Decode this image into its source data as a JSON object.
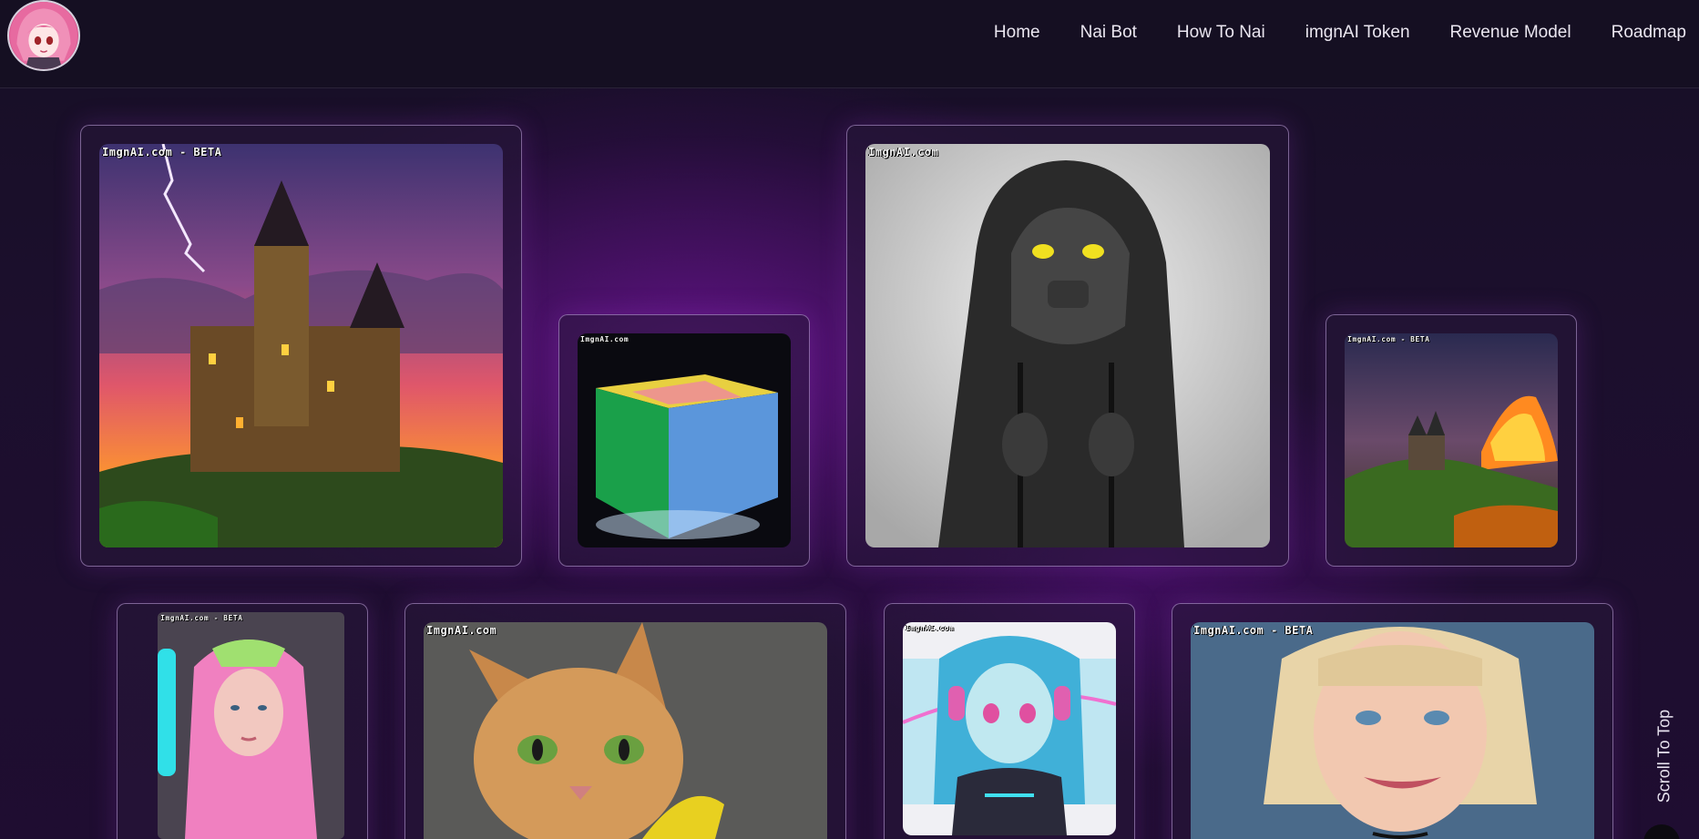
{
  "header": {
    "logo_icon": "anime-girl-avatar-icon",
    "nav": [
      {
        "label": "Home"
      },
      {
        "label": "Nai Bot"
      },
      {
        "label": "How To Nai"
      },
      {
        "label": "imgnAI Token"
      },
      {
        "label": "Revenue Model"
      },
      {
        "label": "Roadmap"
      }
    ]
  },
  "gallery": {
    "items": [
      {
        "subject": "castle-lightning-image",
        "watermark": "ImgnAI.com - BETA"
      },
      {
        "subject": "glowing-cube-image",
        "watermark": "ImgnAI.com"
      },
      {
        "subject": "hooded-figure-image",
        "watermark": "ImgnAI.com"
      },
      {
        "subject": "castle-volcano-image",
        "watermark": "ImgnAI.com - BETA"
      },
      {
        "subject": "pink-hair-woman-image",
        "watermark": "ImgnAI.com - BETA"
      },
      {
        "subject": "cat-portrait-image",
        "watermark": "ImgnAI.com"
      },
      {
        "subject": "anime-headphones-girl-image",
        "watermark": "ImgnAI.com"
      },
      {
        "subject": "blonde-woman-image",
        "watermark": "ImgnAI.com - BETA"
      }
    ]
  },
  "scroll_to_top": {
    "label": "Scroll To Top"
  },
  "colors": {
    "background": "#1c0f2d",
    "glow": "#6e1496",
    "card_border": "#c8aae6",
    "header_bg": "#150f22"
  }
}
